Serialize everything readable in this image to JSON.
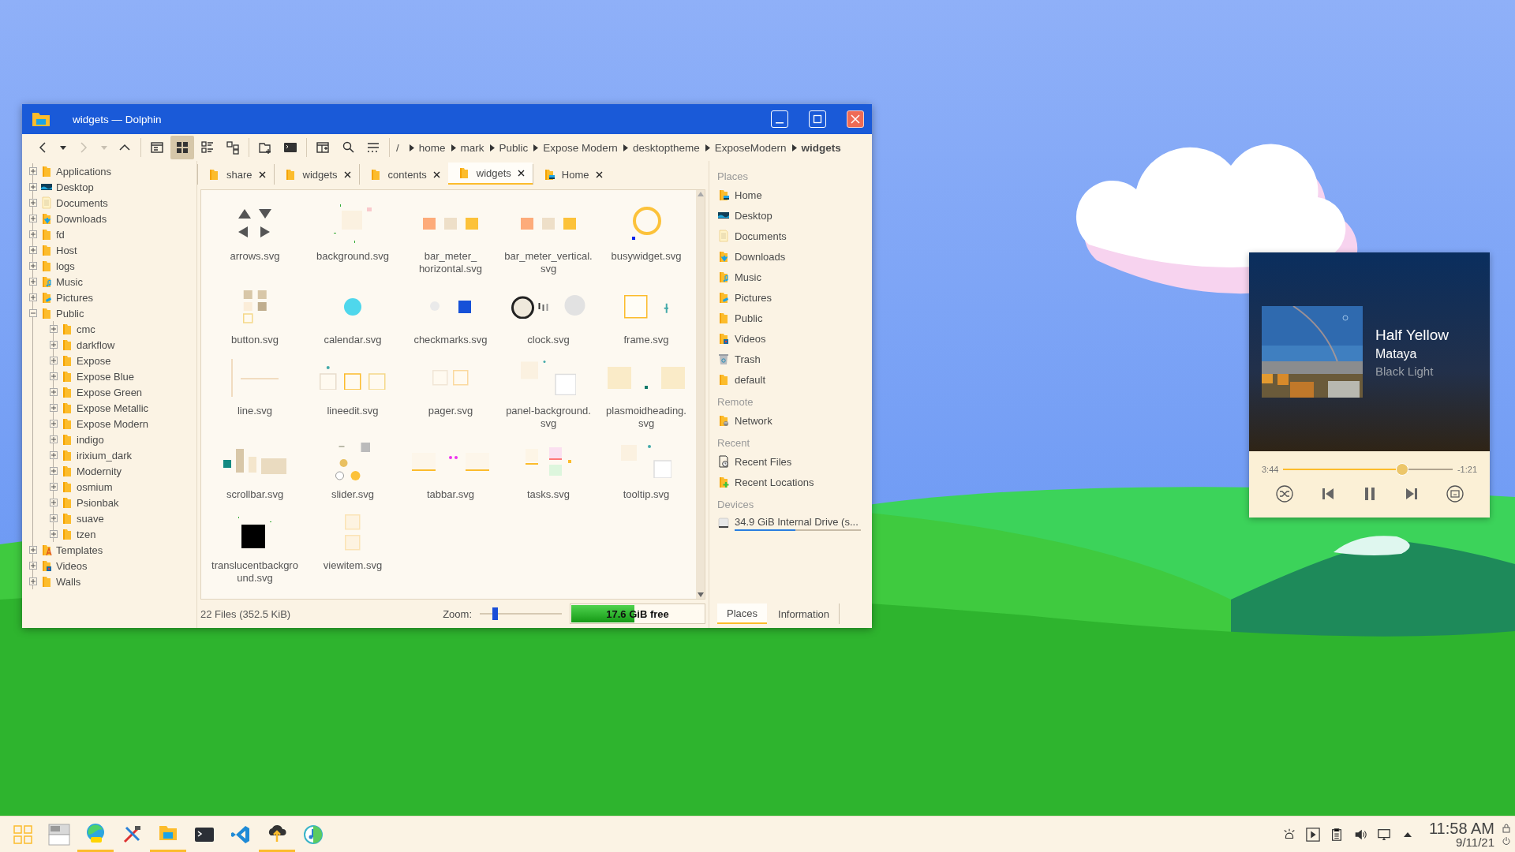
{
  "window": {
    "title": "widgets — Dolphin"
  },
  "toolbar": [
    [
      {
        "kind": "back",
        "disabled": false,
        "selected": false
      },
      {
        "kind": "dropdown",
        "disabled": false,
        "selected": false
      },
      {
        "kind": "forward",
        "disabled": true,
        "selected": false
      },
      {
        "kind": "dropdown",
        "disabled": true,
        "selected": false
      },
      {
        "kind": "up",
        "disabled": false,
        "selected": false
      }
    ],
    [
      {
        "kind": "preview",
        "disabled": false,
        "selected": false
      },
      {
        "kind": "icons",
        "disabled": false,
        "selected": true
      },
      {
        "kind": "details",
        "disabled": false,
        "selected": false
      },
      {
        "kind": "tree",
        "disabled": false,
        "selected": false
      }
    ],
    [
      {
        "kind": "split",
        "disabled": false,
        "selected": false
      },
      {
        "kind": "terminal",
        "disabled": false,
        "selected": false
      }
    ],
    [
      {
        "kind": "panel",
        "disabled": false,
        "selected": false
      },
      {
        "kind": "search",
        "disabled": false,
        "selected": false
      },
      {
        "kind": "menu",
        "disabled": false,
        "selected": false
      }
    ]
  ],
  "breadcrumb": [
    {
      "label": "/",
      "selected": false
    },
    {
      "label": "home",
      "selected": false
    },
    {
      "label": "mark",
      "selected": false
    },
    {
      "label": "Public",
      "selected": false
    },
    {
      "label": "Expose Modern",
      "selected": false
    },
    {
      "label": "desktoptheme",
      "selected": false
    },
    {
      "label": "ExposeModern",
      "selected": false
    },
    {
      "label": "widgets",
      "selected": true
    }
  ],
  "tabs": [
    {
      "label": "share",
      "kind": "folder",
      "selected": false
    },
    {
      "label": "widgets",
      "kind": "folder",
      "selected": false
    },
    {
      "label": "contents",
      "kind": "folder",
      "selected": false
    },
    {
      "label": "widgets",
      "kind": "folder",
      "selected": true
    },
    {
      "label": "Home",
      "kind": "home",
      "selected": false
    }
  ],
  "tree": [
    {
      "label": "Applications",
      "kind": "folder",
      "expanded": false
    },
    {
      "label": "Desktop",
      "kind": "desktop",
      "expanded": false
    },
    {
      "label": "Documents",
      "kind": "documents",
      "expanded": false
    },
    {
      "label": "Downloads",
      "kind": "downloads",
      "expanded": false
    },
    {
      "label": "fd",
      "kind": "folder",
      "expanded": false
    },
    {
      "label": "Host",
      "kind": "folder",
      "expanded": false
    },
    {
      "label": "logs",
      "kind": "folder",
      "expanded": false
    },
    {
      "label": "Music",
      "kind": "music",
      "expanded": false
    },
    {
      "label": "Pictures",
      "kind": "pictures",
      "expanded": false
    },
    {
      "label": "Public",
      "kind": "folder",
      "expanded": true,
      "children": [
        {
          "label": "cmc",
          "kind": "folder",
          "expanded": false
        },
        {
          "label": "darkflow",
          "kind": "folder",
          "expanded": false
        },
        {
          "label": "Expose",
          "kind": "folder",
          "expanded": false
        },
        {
          "label": "Expose Blue",
          "kind": "folder",
          "expanded": false
        },
        {
          "label": "Expose Green",
          "kind": "folder",
          "expanded": false
        },
        {
          "label": "Expose Metallic",
          "kind": "folder",
          "expanded": false
        },
        {
          "label": "Expose Modern",
          "kind": "folder",
          "expanded": false
        },
        {
          "label": "indigo",
          "kind": "folder",
          "expanded": false
        },
        {
          "label": "irixium_dark",
          "kind": "folder",
          "expanded": false
        },
        {
          "label": "Modernity",
          "kind": "folder",
          "expanded": false
        },
        {
          "label": "osmium",
          "kind": "folder",
          "expanded": false
        },
        {
          "label": "Psionbak",
          "kind": "folder",
          "expanded": false
        },
        {
          "label": "suave",
          "kind": "folder",
          "expanded": false
        },
        {
          "label": "tzen",
          "kind": "folder",
          "expanded": false
        }
      ]
    },
    {
      "label": "Templates",
      "kind": "templates",
      "expanded": false
    },
    {
      "label": "Videos",
      "kind": "videos",
      "expanded": false
    },
    {
      "label": "Walls",
      "kind": "folder",
      "expanded": false
    }
  ],
  "files": [
    {
      "name": "arrows.svg"
    },
    {
      "name": "background.svg"
    },
    {
      "name": "bar_meter_ horizontal.svg"
    },
    {
      "name": "bar_meter_vertical. svg"
    },
    {
      "name": "busywidget.svg"
    },
    {
      "name": "button.svg"
    },
    {
      "name": "calendar.svg"
    },
    {
      "name": "checkmarks.svg"
    },
    {
      "name": "clock.svg"
    },
    {
      "name": "frame.svg"
    },
    {
      "name": "line.svg"
    },
    {
      "name": "lineedit.svg"
    },
    {
      "name": "pager.svg"
    },
    {
      "name": "panel-background. svg"
    },
    {
      "name": "plasmoidheading. svg"
    },
    {
      "name": "scrollbar.svg"
    },
    {
      "name": "slider.svg"
    },
    {
      "name": "tabbar.svg"
    },
    {
      "name": "tasks.svg"
    },
    {
      "name": "tooltip.svg"
    },
    {
      "name": "translucentbackgro und.svg"
    },
    {
      "name": "viewitem.svg"
    }
  ],
  "status_bar": {
    "summary": "22 Files (352.5 KiB)",
    "zoom_label": "Zoom:",
    "zoom": {
      "level": 0.18
    },
    "free_space": {
      "label": "17.6 GiB free",
      "level": 0.47
    }
  },
  "places_panel": {
    "sections": [
      {
        "title": "Places",
        "items": [
          {
            "label": "Home",
            "kind": "home"
          },
          {
            "label": "Desktop",
            "kind": "desktop"
          },
          {
            "label": "Documents",
            "kind": "documents"
          },
          {
            "label": "Downloads",
            "kind": "downloads"
          },
          {
            "label": "Music",
            "kind": "music"
          },
          {
            "label": "Pictures",
            "kind": "pictures"
          },
          {
            "label": "Public",
            "kind": "folder"
          },
          {
            "label": "Videos",
            "kind": "videos"
          },
          {
            "label": "Trash",
            "kind": "trash"
          },
          {
            "label": "default",
            "kind": "folder"
          }
        ]
      },
      {
        "title": "Remote",
        "items": [
          {
            "label": "Network",
            "kind": "network"
          }
        ]
      },
      {
        "title": "Recent",
        "items": [
          {
            "label": "Recent Files",
            "kind": "recent"
          },
          {
            "label": "Recent Locations",
            "kind": "recentfolder"
          }
        ]
      },
      {
        "title": "Devices",
        "items": [
          {
            "label": "34.9 GiB Internal Drive (s...",
            "kind": "drive",
            "level": 0.48
          }
        ]
      }
    ],
    "tabs": [
      {
        "label": "Places",
        "selected": true
      },
      {
        "label": "Information",
        "selected": false
      }
    ]
  },
  "media_player": {
    "title": "Half Yellow",
    "artist": "Mataya",
    "album": "Black Light",
    "elapsed": "3:44",
    "remaining": "-1:21",
    "progress": {
      "level": 0.7
    }
  },
  "taskbar": {
    "launchers": [
      {
        "kind": "apps",
        "running": false
      },
      {
        "kind": "pager",
        "running": false
      },
      {
        "kind": "browser",
        "running": true
      },
      {
        "kind": "tools",
        "running": false
      },
      {
        "kind": "files",
        "running": true
      },
      {
        "kind": "terminal",
        "running": false
      },
      {
        "kind": "editor",
        "running": false
      },
      {
        "kind": "upload",
        "running": true
      },
      {
        "kind": "music",
        "running": false
      }
    ],
    "time": "11:58 AM",
    "date": "9/11/21"
  }
}
